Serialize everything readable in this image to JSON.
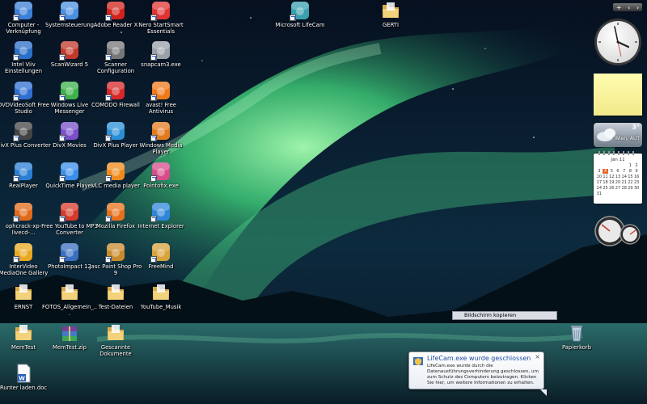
{
  "desktop": {
    "icons": [
      {
        "label": "Computer - Verknüpfung",
        "icon": "computer-icon",
        "color": "#3c7fd6"
      },
      {
        "label": "Systemsteuerung",
        "icon": "control-panel-icon",
        "color": "#4b8fe0"
      },
      {
        "label": "Adobe Reader X",
        "icon": "adobe-reader-icon",
        "color": "#d0231b"
      },
      {
        "label": "Nero StartSmart Essentials",
        "icon": "nero-icon",
        "color": "#e03434"
      },
      {
        "label": "Microsoft LifeCam",
        "icon": "webcam-icon",
        "color": "#3aa0b0"
      },
      {
        "label": "GERTI",
        "icon": "folder-icon",
        "color": "#e9c86a"
      },
      {
        "label": "Intel Viiv Einstellungen",
        "icon": "intel-icon",
        "color": "#2a6fc9"
      },
      {
        "label": "ScanWizard 5",
        "icon": "scanner-icon",
        "color": "#c0392b"
      },
      {
        "label": "Scanner Configuration",
        "icon": "scanner-config-icon",
        "color": "#777777"
      },
      {
        "label": "snapcam3.exe",
        "icon": "exe-icon",
        "color": "#9aa0a8"
      },
      {
        "label": "DVDVideoSoft Free Studio",
        "icon": "dvdvideosoft-icon",
        "color": "#2f6fd0"
      },
      {
        "label": "Windows Live Messenger",
        "icon": "messenger-icon",
        "color": "#3db14a"
      },
      {
        "label": "COMODO Firewall",
        "icon": "comodo-icon",
        "color": "#d62828"
      },
      {
        "label": "avast! Free Antivirus",
        "icon": "avast-icon",
        "color": "#f07a1a"
      },
      {
        "label": "DivX Plus Converter",
        "icon": "divx-converter-icon",
        "color": "#444444"
      },
      {
        "label": "DivX Movies",
        "icon": "divx-movies-icon",
        "color": "#7a4fc9"
      },
      {
        "label": "DivX Plus Player",
        "icon": "divx-player-icon",
        "color": "#2b8fd6"
      },
      {
        "label": "Windows Media Player",
        "icon": "media-player-icon",
        "color": "#e07b20"
      },
      {
        "label": "RealPlayer",
        "icon": "realplayer-icon",
        "color": "#2a7fd4"
      },
      {
        "label": "QuickTime Player",
        "icon": "quicktime-icon",
        "color": "#3a8ee8"
      },
      {
        "label": "VLC media player",
        "icon": "vlc-icon",
        "color": "#f08a1c"
      },
      {
        "label": "Pointofix.exe",
        "icon": "pointofix-icon",
        "color": "#d64d8a"
      },
      {
        "label": "ophcrack-xp-livecd-...",
        "icon": "ophcrack-icon",
        "color": "#e06a1a"
      },
      {
        "label": "Free YouTube to MP3 Converter",
        "icon": "youtube-mp3-icon",
        "color": "#d63a2a"
      },
      {
        "label": "Mozilla Firefox",
        "icon": "firefox-icon",
        "color": "#e8701c"
      },
      {
        "label": "Internet Explorer",
        "icon": "internet-explorer-icon",
        "color": "#2f86d8"
      },
      {
        "label": "InterVideo MediaOne Gallery",
        "icon": "mediaone-icon",
        "color": "#e8a820"
      },
      {
        "label": "PhotoImpact 12",
        "icon": "photoimpact-icon",
        "color": "#3a6fbf"
      },
      {
        "label": "Jasc Paint Shop Pro 9",
        "icon": "paint-shop-icon",
        "color": "#c98a2c"
      },
      {
        "label": "FreeMind",
        "icon": "freemind-icon",
        "color": "#d9a23a"
      },
      {
        "label": "ERNST",
        "icon": "folder-icon",
        "color": "#e9c86a"
      },
      {
        "label": "FOTOS_Allgemein_...",
        "icon": "folder-icon",
        "color": "#e9c86a"
      },
      {
        "label": "Test-Dateien",
        "icon": "folder-icon",
        "color": "#e9c86a"
      },
      {
        "label": "YouTube_Musik",
        "icon": "folder-icon",
        "color": "#e9c86a"
      },
      {
        "label": "MemTest",
        "icon": "folder-icon",
        "color": "#e9c86a"
      },
      {
        "label": "MemTest.zip",
        "icon": "zip-archive-icon",
        "color": "#8b4fa0"
      },
      {
        "label": "Gescannte Dokumente",
        "icon": "folder-icon",
        "color": "#e9c86a"
      },
      {
        "label": "Papierkorb",
        "icon": "recycle-bin-icon",
        "color": "#c7d3de"
      },
      {
        "label": "Runter laden.doc",
        "icon": "word-document-icon",
        "color": "#2b5fb8"
      }
    ]
  },
  "gadgets": {
    "weather": {
      "temperature": "3°",
      "location": "Wien, AUT"
    },
    "calendar": {
      "month": "Jän 11",
      "days": [
        "1",
        "2",
        "3",
        "4",
        "5",
        "6",
        "7",
        "8",
        "9",
        "10",
        "11",
        "12",
        "13",
        "14",
        "15",
        "16",
        "17",
        "18",
        "19",
        "20",
        "21",
        "22",
        "23",
        "24",
        "25",
        "26",
        "27",
        "28",
        "29",
        "30",
        "31"
      ],
      "today": "4"
    }
  },
  "tooltip": {
    "text": "Bildschirm kopieren"
  },
  "notification": {
    "title": "LifeCam.exe wurde geschlossen",
    "body": "LifeCam.exe wurde durch die Datenausführungsverhinderung geschlossen, um zum Schutz des Computers beizutragen. Klicken Sie hier, um weitere Informationen zu erhalten.",
    "close": "×"
  },
  "colors": {
    "aurora": "#3fd07a",
    "sky": "#0a1c33",
    "note": "#fff6a0",
    "accent": "#1e4da0"
  }
}
